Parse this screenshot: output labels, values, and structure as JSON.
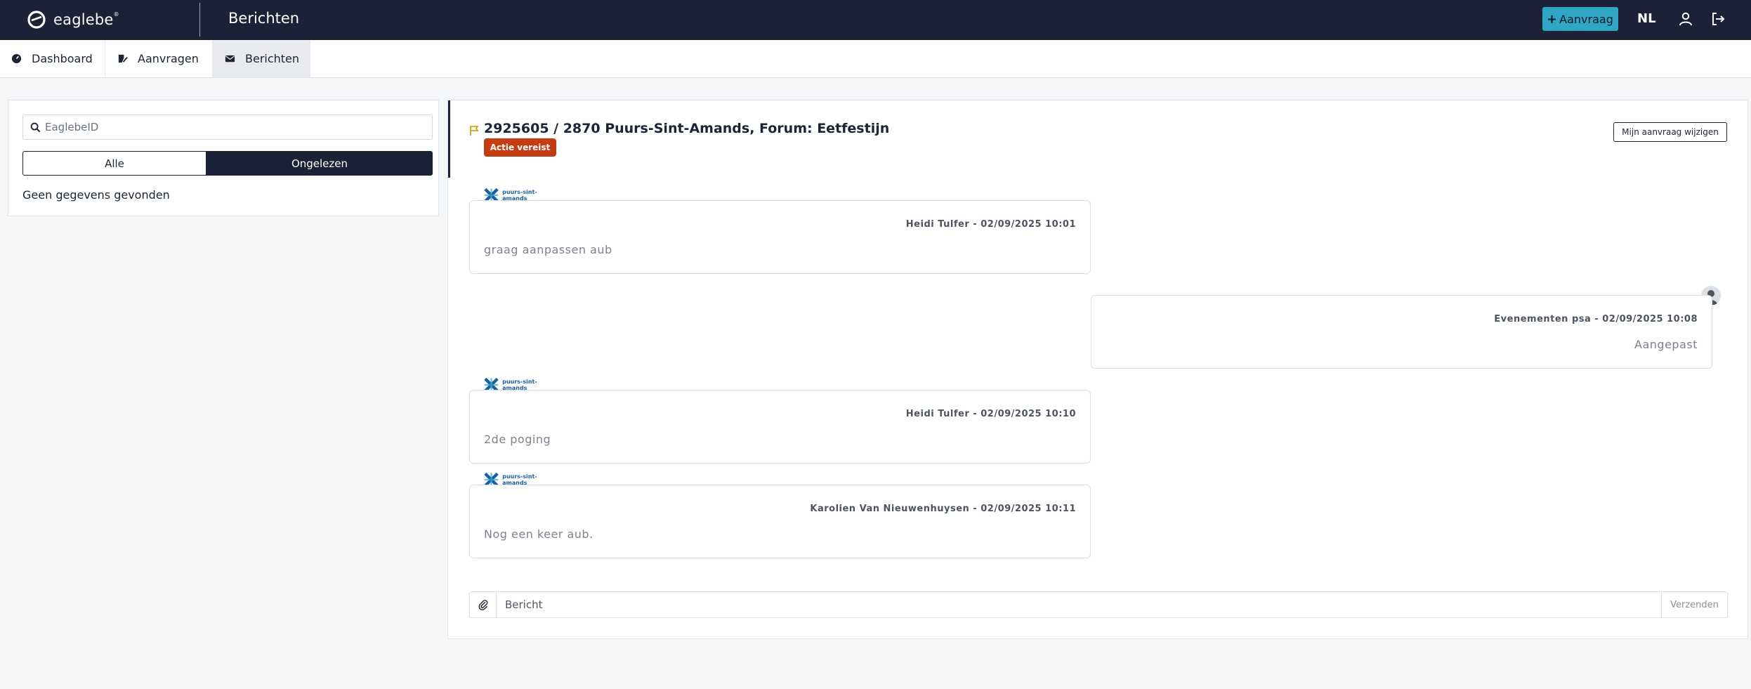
{
  "app": {
    "logo_text": "eaglebe",
    "logo_mark": "®",
    "page_title": "Berichten"
  },
  "topbar": {
    "new_button_label": "Aanvraag",
    "language": "NL",
    "icons": [
      "plus-icon",
      "user-icon",
      "logout-icon"
    ]
  },
  "tabs": [
    {
      "label": "Dashboard",
      "icon": "dashboard-icon"
    },
    {
      "label": "Aanvragen",
      "icon": "edit-document-icon"
    },
    {
      "label": "Berichten",
      "icon": "envelope-icon",
      "active": true
    }
  ],
  "sidebar": {
    "search_placeholder": "EaglebeID",
    "filters": [
      {
        "label": "Alle",
        "active": false
      },
      {
        "label": "Ongelezen",
        "active": true
      }
    ],
    "empty_text": "Geen gegevens gevonden"
  },
  "conversation": {
    "title": "2925605 / 2870 Puurs-Sint-Amands, Forum: Eetfestijn",
    "badge": "Actie vereist",
    "edit_button": "Mijn aanvraag wijzigen",
    "org_logo_text": "puurs-sint-amands",
    "messages": [
      {
        "side": "left",
        "sender": "Heidi Tulfer",
        "timestamp": "02/09/2025 10:01",
        "text": "graag aanpassen aub"
      },
      {
        "side": "right",
        "sender": "Evenementen psa",
        "timestamp": "02/09/2025 10:08",
        "text": "Aangepast"
      },
      {
        "side": "left",
        "sender": "Heidi Tulfer",
        "timestamp": "02/09/2025 10:10",
        "text": "2de poging"
      },
      {
        "side": "left",
        "sender": "Karolien Van Nieuwenhuysen",
        "timestamp": "02/09/2025 10:11",
        "text": "Nog een keer aub."
      }
    ],
    "composer": {
      "placeholder": "Bericht",
      "send_label": "Verzenden"
    }
  },
  "colors": {
    "navy": "#1b2136",
    "accent_blue": "#2fa6c4",
    "badge_red": "#c43d12",
    "flag_gold": "#d9a21b",
    "background": "#f5f6f8"
  }
}
